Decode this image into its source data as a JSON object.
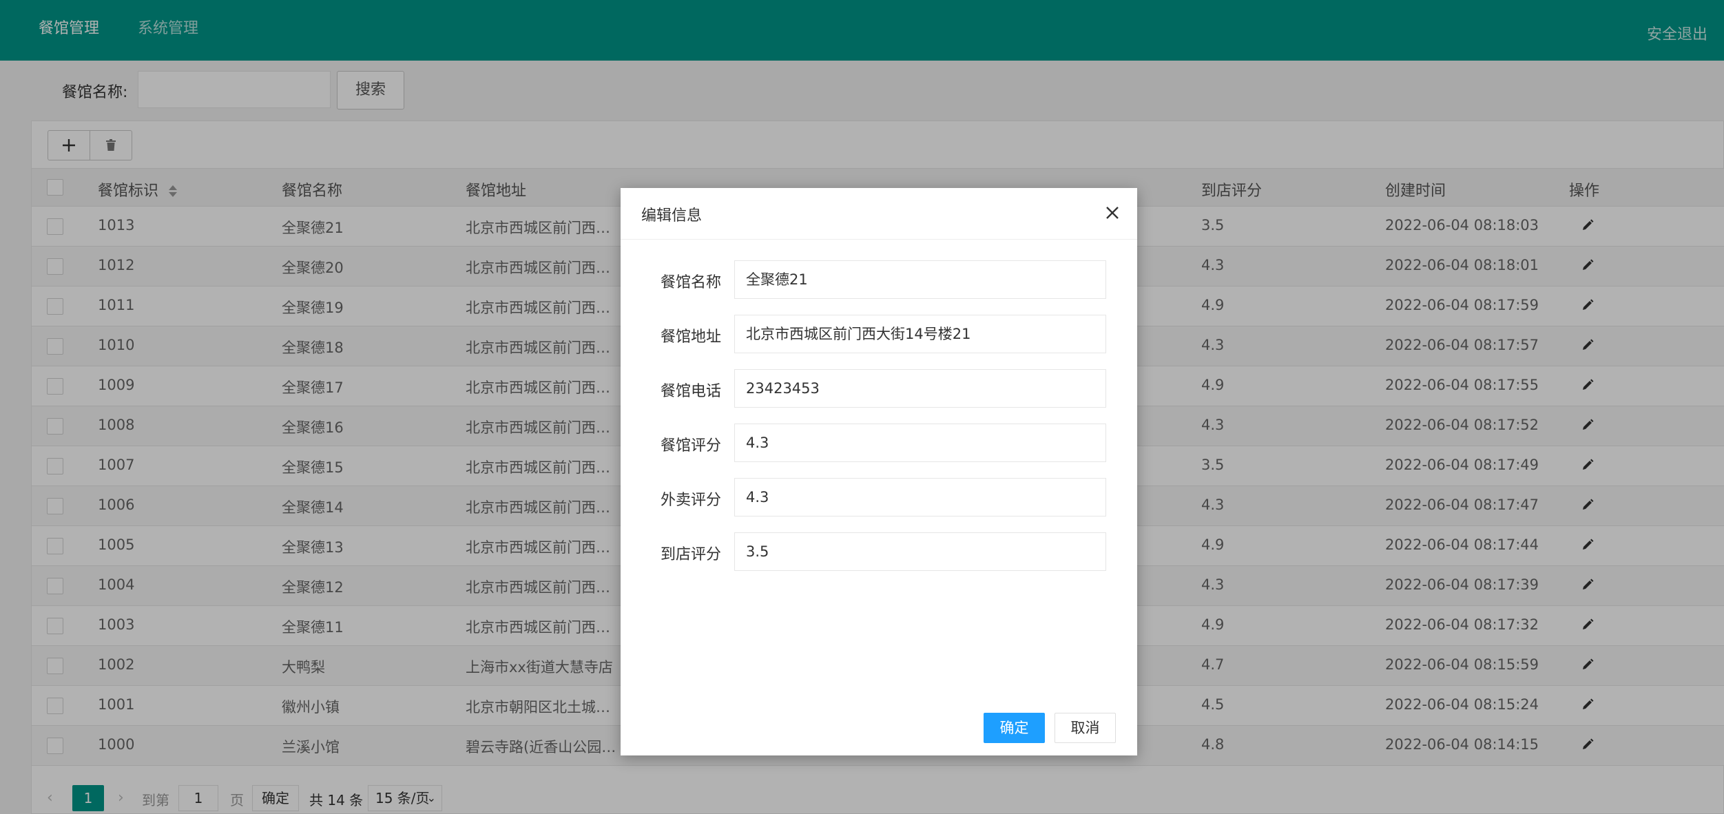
{
  "header": {
    "nav": [
      "餐馆管理",
      "系统管理"
    ],
    "logout": "安全退出"
  },
  "search": {
    "label": "餐馆名称:",
    "input_value": "",
    "button": "搜索"
  },
  "toolbar": {
    "add_icon": "plus-icon",
    "delete_icon": "trash-icon"
  },
  "table": {
    "headers": [
      "餐馆标识",
      "餐馆名称",
      "餐馆地址",
      "到店评分",
      "创建时间",
      "操作"
    ],
    "rows": [
      {
        "id": "1013",
        "name": "全聚德21",
        "address": "北京市西城区前门西…",
        "store_score": "3.5",
        "created": "2022-06-04 08:18:03"
      },
      {
        "id": "1012",
        "name": "全聚德20",
        "address": "北京市西城区前门西…",
        "store_score": "4.3",
        "created": "2022-06-04 08:18:01"
      },
      {
        "id": "1011",
        "name": "全聚德19",
        "address": "北京市西城区前门西…",
        "store_score": "4.9",
        "created": "2022-06-04 08:17:59"
      },
      {
        "id": "1010",
        "name": "全聚德18",
        "address": "北京市西城区前门西…",
        "store_score": "4.3",
        "created": "2022-06-04 08:17:57"
      },
      {
        "id": "1009",
        "name": "全聚德17",
        "address": "北京市西城区前门西…",
        "store_score": "4.9",
        "created": "2022-06-04 08:17:55"
      },
      {
        "id": "1008",
        "name": "全聚德16",
        "address": "北京市西城区前门西…",
        "store_score": "4.3",
        "created": "2022-06-04 08:17:52"
      },
      {
        "id": "1007",
        "name": "全聚德15",
        "address": "北京市西城区前门西…",
        "store_score": "3.5",
        "created": "2022-06-04 08:17:49"
      },
      {
        "id": "1006",
        "name": "全聚德14",
        "address": "北京市西城区前门西…",
        "store_score": "4.3",
        "created": "2022-06-04 08:17:47"
      },
      {
        "id": "1005",
        "name": "全聚德13",
        "address": "北京市西城区前门西…",
        "store_score": "4.9",
        "created": "2022-06-04 08:17:44"
      },
      {
        "id": "1004",
        "name": "全聚德12",
        "address": "北京市西城区前门西…",
        "store_score": "4.3",
        "created": "2022-06-04 08:17:39"
      },
      {
        "id": "1003",
        "name": "全聚德11",
        "address": "北京市西城区前门西…",
        "store_score": "4.9",
        "created": "2022-06-04 08:17:32"
      },
      {
        "id": "1002",
        "name": "大鸭梨",
        "address": "上海市xx街道大慧寺店",
        "store_score": "4.7",
        "created": "2022-06-04 08:15:59"
      },
      {
        "id": "1001",
        "name": "徽州小镇",
        "address": "北京市朝阳区北土城…",
        "store_score": "4.5",
        "created": "2022-06-04 08:15:24"
      },
      {
        "id": "1000",
        "name": "兰溪小馆",
        "address": "碧云寺路(近香山公园…",
        "store_score": "4.8",
        "created": "2022-06-04 08:14:15"
      }
    ]
  },
  "pager": {
    "current": "1",
    "goto_label": "到第",
    "goto_value": "1",
    "page_unit": "页",
    "confirm": "确定",
    "total": "共 14 条",
    "page_size": "15 条/页"
  },
  "modal": {
    "title": "编辑信息",
    "fields": [
      {
        "label": "餐馆名称",
        "value": "全聚德21"
      },
      {
        "label": "餐馆地址",
        "value": "北京市西城区前门西大街14号楼21"
      },
      {
        "label": "餐馆电话",
        "value": "23423453"
      },
      {
        "label": "餐馆评分",
        "value": "4.3"
      },
      {
        "label": "外卖评分",
        "value": "4.3"
      },
      {
        "label": "到店评分",
        "value": "3.5"
      }
    ],
    "ok": "确定",
    "cancel": "取消"
  },
  "colors": {
    "header": "#009688",
    "primary_button": "#1e9fff"
  }
}
